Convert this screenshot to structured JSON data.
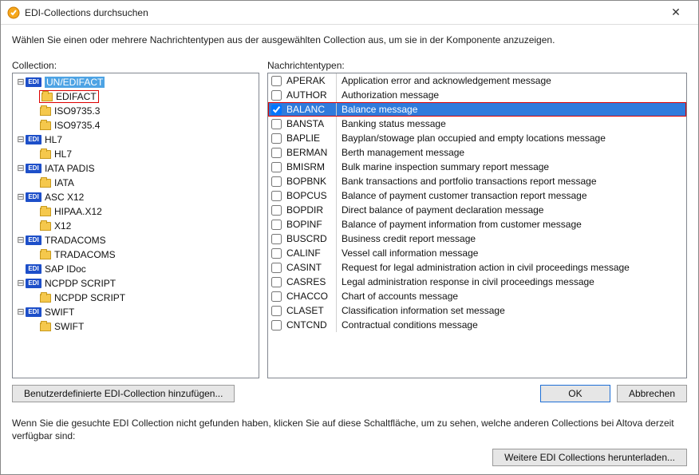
{
  "window": {
    "title": "EDI-Collections durchsuchen"
  },
  "intro": "Wählen Sie einen oder mehrere Nachrichtentypen aus der ausgewählten Collection aus, um sie in der Komponente anzuzeigen.",
  "labels": {
    "collection": "Collection:",
    "messageTypes": "Nachrichtentypen:"
  },
  "tree": {
    "badge": "EDI",
    "items": [
      {
        "level": 1,
        "type": "edi",
        "label": "UN/EDIFACT",
        "expander": "−",
        "selected": true
      },
      {
        "level": 2,
        "type": "folder",
        "label": "EDIFACT",
        "expander": "",
        "red": true
      },
      {
        "level": 2,
        "type": "folder",
        "label": "ISO9735.3",
        "expander": ""
      },
      {
        "level": 2,
        "type": "folder",
        "label": "ISO9735.4",
        "expander": ""
      },
      {
        "level": 1,
        "type": "edi",
        "label": "HL7",
        "expander": "−"
      },
      {
        "level": 2,
        "type": "folder",
        "label": "HL7",
        "expander": ""
      },
      {
        "level": 1,
        "type": "edi",
        "label": "IATA PADIS",
        "expander": "−"
      },
      {
        "level": 2,
        "type": "folder",
        "label": "IATA",
        "expander": ""
      },
      {
        "level": 1,
        "type": "edi",
        "label": "ASC X12",
        "expander": "−"
      },
      {
        "level": 2,
        "type": "folder",
        "label": "HIPAA.X12",
        "expander": ""
      },
      {
        "level": 2,
        "type": "folder",
        "label": "X12",
        "expander": ""
      },
      {
        "level": 1,
        "type": "edi",
        "label": "TRADACOMS",
        "expander": "−"
      },
      {
        "level": 2,
        "type": "folder",
        "label": "TRADACOMS",
        "expander": ""
      },
      {
        "level": 1,
        "type": "edi",
        "label": "SAP IDoc",
        "expander": ""
      },
      {
        "level": 1,
        "type": "edi",
        "label": "NCPDP SCRIPT",
        "expander": "−"
      },
      {
        "level": 2,
        "type": "folder",
        "label": "NCPDP SCRIPT",
        "expander": ""
      },
      {
        "level": 1,
        "type": "edi",
        "label": "SWIFT",
        "expander": "−"
      },
      {
        "level": 2,
        "type": "folder",
        "label": "SWIFT",
        "expander": ""
      }
    ]
  },
  "messages": {
    "selectedIndex": 2,
    "items": [
      {
        "code": "APERAK",
        "desc": "Application error and acknowledgement message",
        "checked": false
      },
      {
        "code": "AUTHOR",
        "desc": "Authorization message",
        "checked": false
      },
      {
        "code": "BALANC",
        "desc": "Balance message",
        "checked": true
      },
      {
        "code": "BANSTA",
        "desc": "Banking status message",
        "checked": false
      },
      {
        "code": "BAPLIE",
        "desc": "Bayplan/stowage plan occupied and empty locations message",
        "checked": false
      },
      {
        "code": "BERMAN",
        "desc": "Berth management message",
        "checked": false
      },
      {
        "code": "BMISRM",
        "desc": "Bulk marine inspection summary report message",
        "checked": false
      },
      {
        "code": "BOPBNK",
        "desc": "Bank transactions and portfolio transactions report message",
        "checked": false
      },
      {
        "code": "BOPCUS",
        "desc": "Balance of payment customer transaction report message",
        "checked": false
      },
      {
        "code": "BOPDIR",
        "desc": "Direct balance of payment declaration message",
        "checked": false
      },
      {
        "code": "BOPINF",
        "desc": "Balance of payment information from customer message",
        "checked": false
      },
      {
        "code": "BUSCRD",
        "desc": "Business credit report message",
        "checked": false
      },
      {
        "code": "CALINF",
        "desc": "Vessel call information message",
        "checked": false
      },
      {
        "code": "CASINT",
        "desc": "Request for legal administration action in civil proceedings message",
        "checked": false
      },
      {
        "code": "CASRES",
        "desc": "Legal administration response in civil proceedings message",
        "checked": false
      },
      {
        "code": "CHACCO",
        "desc": "Chart of accounts message",
        "checked": false
      },
      {
        "code": "CLASET",
        "desc": "Classification information set message",
        "checked": false
      },
      {
        "code": "CNTCND",
        "desc": "Contractual conditions message",
        "checked": false
      }
    ]
  },
  "buttons": {
    "addCustom": "Benutzerdefinierte EDI-Collection hinzufügen...",
    "ok": "OK",
    "cancel": "Abbrechen",
    "download": "Weitere EDI Collections herunterladen..."
  },
  "footer": "Wenn Sie die gesuchte EDI Collection nicht gefunden haben, klicken Sie auf diese Schaltfläche, um zu sehen, welche anderen Collections bei Altova derzeit verfügbar sind:"
}
